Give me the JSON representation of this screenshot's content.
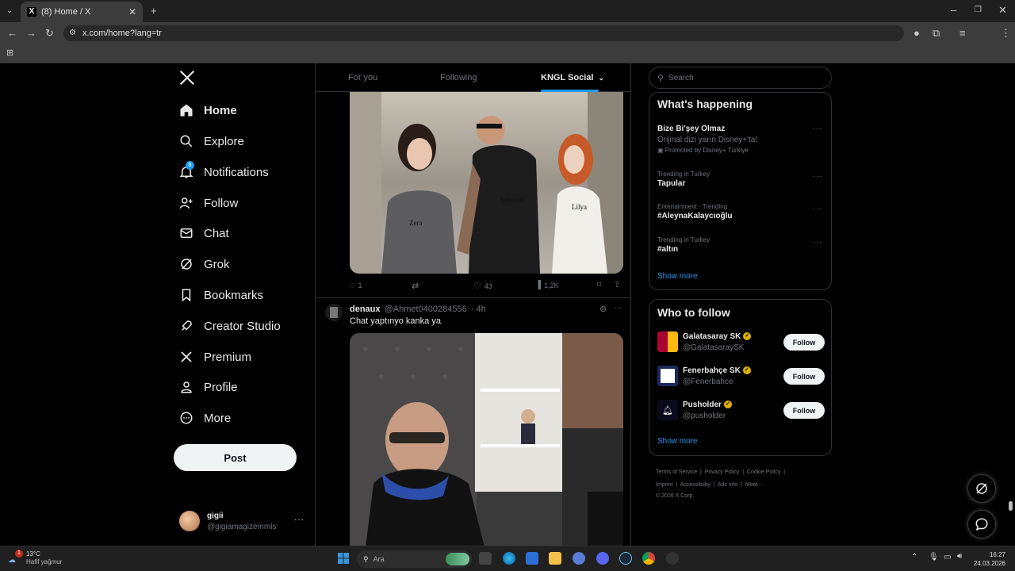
{
  "browser": {
    "tab_title": "(8) Home / X",
    "url": "x.com/home?lang=tr"
  },
  "sidebar": {
    "items": [
      {
        "label": "Home"
      },
      {
        "label": "Explore"
      },
      {
        "label": "Notifications",
        "badge": "8"
      },
      {
        "label": "Follow"
      },
      {
        "label": "Chat"
      },
      {
        "label": "Grok"
      },
      {
        "label": "Bookmarks"
      },
      {
        "label": "Creator Studio"
      },
      {
        "label": "Premium"
      },
      {
        "label": "Profile"
      },
      {
        "label": "More"
      }
    ],
    "post_label": "Post",
    "account": {
      "name": "gigii",
      "handle": "@gigiamagizemmls"
    }
  },
  "feed": {
    "tabs": [
      "For you",
      "Following",
      "KNGL Social"
    ],
    "tweet1": {
      "image_labels": [
        "Zera",
        "Şehmus",
        "Lilya"
      ],
      "replies": "1",
      "likes": "43",
      "views": "1,2K"
    },
    "tweet2": {
      "author": "denaux",
      "handle": "@Ahmet0400284556",
      "time": "· 4h",
      "text": "Chat yaptınyo kanka ya"
    }
  },
  "right": {
    "search_placeholder": "Search",
    "happening": {
      "title": "What's happening",
      "promo": {
        "name": "Bize Bi'şey Olmaz",
        "desc": "Orijinal dizi yarın Disney+'ta!",
        "promoted": "Promoted by Disney+ Türkiye"
      },
      "trends": [
        {
          "meta": "Trending in Turkey",
          "name": "Tapular"
        },
        {
          "meta": "Entertainment · Trending",
          "name": "#AleynaKalaycıoğlu"
        },
        {
          "meta": "Trending in Turkey",
          "name": "#altın"
        }
      ],
      "show_more": "Show more"
    },
    "who_to_follow": {
      "title": "Who to follow",
      "accounts": [
        {
          "name": "Galatasaray SK",
          "handle": "@GalatasaraySK",
          "button": "Follow"
        },
        {
          "name": "Fenerbahçe SK",
          "handle": "@Fenerbahce",
          "button": "Follow"
        },
        {
          "name": "Pusholder",
          "handle": "@pusholder",
          "button": "Follow"
        }
      ],
      "show_more": "Show more"
    },
    "footer": {
      "links1": [
        "Terms of Service",
        "Privacy Policy",
        "Cookie Policy"
      ],
      "links2": [
        "Imprint",
        "Accessibility",
        "Ads info",
        "More ···"
      ],
      "copyright": "© 2026 X Corp."
    }
  },
  "taskbar": {
    "temp": "13°C",
    "weather": "Hafif yağmur",
    "weather_badge": "1",
    "search": "Ara",
    "time": "16:27",
    "date": "24.03.2026"
  },
  "colors": {
    "accent": "#1d9bf0",
    "background": "#000000",
    "border": "#2f3336"
  }
}
